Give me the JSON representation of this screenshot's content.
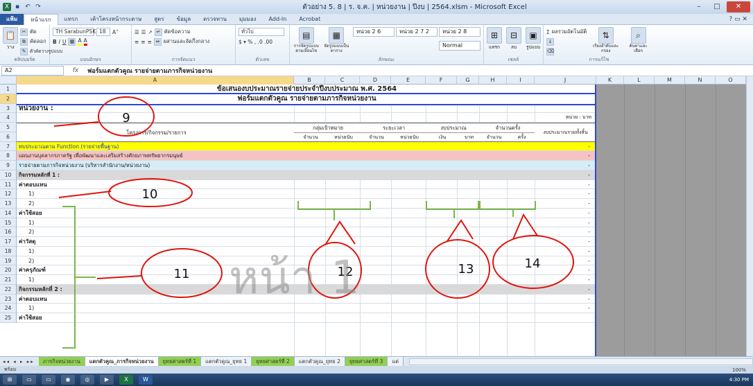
{
  "window": {
    "title": "ตัวอย่าง 5. 8 | ร. จ.ค. | หน่วยงาน | ปีงบ | 2564.xlsm - Microsoft Excel",
    "qat_icons": [
      "excel-icon",
      "save-icon",
      "undo-icon",
      "redo-icon"
    ]
  },
  "ribbon_tabs": [
    "แฟ้ม",
    "หน้าแรก",
    "แทรก",
    "เค้าโครงหน้ากระดาษ",
    "สูตร",
    "ข้อมูล",
    "ตรวจทาน",
    "มุมมอง",
    "Add-In",
    "Acrobat"
  ],
  "ribbon": {
    "clipboard_label": "คลิปบอร์ด",
    "paste_label": "วาง",
    "cut_label": "ตัด",
    "copy_label": "คัดลอก",
    "format_painter_label": "ตัวคัดวางรูปแบบ",
    "font_name": "TH SarabunPSK",
    "font_size": "18",
    "font_label": "แบบอักษร",
    "align_label": "การจัดแนว",
    "wrap_label": "ตัดข้อความ",
    "merge_label": "ผสานและจัดกึ่งกลาง",
    "number_format": "ทั่วไป",
    "number_label": "ตัวเลข",
    "cond_format_label": "การจัดรูปแบบตามเงื่อนไข",
    "table_format_label": "จัดรูปแบบเป็นตาราง",
    "style1": "หน่วย 2 6",
    "style2": "หน่วย 2 7 2",
    "style3": "หน่วย 2 8",
    "style_normal": "Normal",
    "styles_label": "ลักษณะ",
    "insert_label": "แทรก",
    "delete_label": "ลบ",
    "format_label": "รูปแบบ",
    "cells_label": "เซลล์",
    "autosum_label": "ผลรวมอัตโนมัติ",
    "sort_label": "เรียงลำดับและกรอง",
    "find_label": "ค้นหาและเลือก",
    "editing_label": "การแก้ไข"
  },
  "formula_bar": {
    "name_box": "A2",
    "fx": "fx",
    "formula": "ฟอร์มแตกตัวคูณ รายจ่ายตามภารกิจหน่วยงาน"
  },
  "columns": [
    "A",
    "B",
    "C",
    "D",
    "E",
    "F",
    "G",
    "H",
    "I",
    "J",
    "K",
    "L",
    "M",
    "N",
    "O"
  ],
  "rows": [
    "1",
    "2",
    "3",
    "4",
    "5",
    "6",
    "7",
    "8",
    "9",
    "10",
    "11",
    "12",
    "13",
    "14",
    "15",
    "16",
    "17",
    "18",
    "19",
    "20",
    "21",
    "22",
    "23",
    "24",
    "25"
  ],
  "sheet": {
    "title1": "ข้อเสนองบประมาณรายจ่ายประจำปีงบประมาณ พ.ศ. 2564",
    "title2": "ฟอร์มแตกตัวคูณ รายจ่ายตามภารกิจหน่วยงาน",
    "agency_label": "หน่วยงาน :",
    "unit_label": "หน่วย : บาท",
    "hdr_project": "โครงการ/กิจกรรม/รายการ",
    "hdr_target": "กลุ่มเป้าหมาย",
    "hdr_target_qty": "จำนวน",
    "hdr_target_unit": "หน่วยนับ",
    "hdr_period": "ระยะเวลา",
    "hdr_period_qty": "จำนวน",
    "hdr_period_unit": "หน่วยนับ",
    "hdr_budget": "งบประมาณ",
    "hdr_budget_baht": "เงิน",
    "hdr_budget_unit": "บาท",
    "hdr_times": "จำนวนครั้ง",
    "hdr_times_qty": "จำนวน",
    "hdr_times_unit": "ครั้ง",
    "hdr_total": "งบประมาณรวมทั้งสิ้น",
    "row7": "ทบประมาณตาม Function (รายจ่ายพื้นฐาน)",
    "row8": "แผนงานบุคลากรภาครัฐ เพื่อพัฒนาและเสริมสร้างศักยภาพทรัพยากรมนุษย์",
    "row9": "รายจ่ายตามภารกิจหน่วยงาน (บริหารสำนักงาน/หน่วยงาน)",
    "row10": "กิจกรรมหลักที่ 1 :",
    "row11": "ค่าตอบแทน",
    "row12": "1)",
    "row13": "2)",
    "row14": "ค่าใช้สอย",
    "row15": "1)",
    "row16": "2)",
    "row17": "ค่าวัสดุ",
    "row18": "1)",
    "row19": "2)",
    "row20": "ค่าครุภัณฑ์",
    "row21": "1)",
    "row22": "กิจกรรมหลักที่ 2 :",
    "row23": "ค่าตอบแทน",
    "row24": "1)",
    "row25": "ค่าใช้สอย",
    "dash": "-"
  },
  "sheet_tabs": [
    "ภารกิจหน่วยงาน",
    "แตกตัวคูณ_ภารกิจหน่วยงาน",
    "ยุทธศาสตร์ที่ 1",
    "แตกตัวคูณ_ยุทธ 1",
    "ยุทธศาสตร์ที่ 2",
    "แตกตัวคูณ_ยุทธ 2",
    "ยุทธศาสตร์ที่ 3",
    "แต่"
  ],
  "status": {
    "ready": "พร้อม",
    "zoom": "100%"
  },
  "taskbar": {
    "clock": "4:30 PM"
  },
  "annotations": {
    "n9": "9",
    "n10": "10",
    "n11": "11",
    "n12": "12",
    "n13": "13",
    "n14": "14",
    "watermark": "หน้า 1"
  },
  "colors": {
    "annotation_red": "#e0140c",
    "annotation_green": "#7ab648",
    "highlight_yellow": "#ffff00",
    "selection_blue": "#2b47d9"
  }
}
